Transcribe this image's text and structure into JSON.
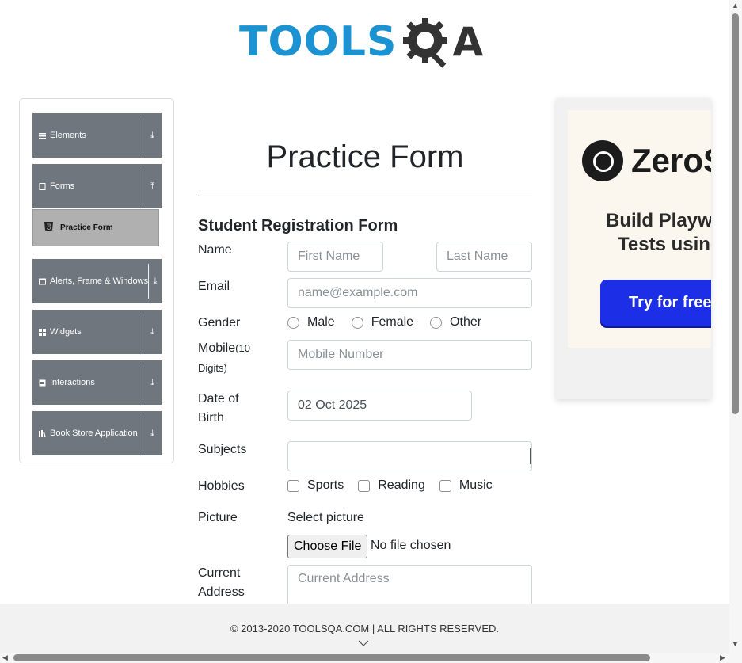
{
  "logo": {
    "text": "TOOLS",
    "suffix": "A"
  },
  "sidebar": {
    "groups": [
      {
        "label": "Elements",
        "icon": "hamburger-icon",
        "arrow": "⤓"
      },
      {
        "label": "Forms",
        "icon": "file-icon",
        "arrow": "⤒"
      },
      {
        "label": "Alerts, Frame & Windows",
        "icon": "window-icon",
        "arrow": "⤓"
      },
      {
        "label": "Widgets",
        "icon": "grid-icon",
        "arrow": "⤓"
      },
      {
        "label": "Interactions",
        "icon": "list-icon",
        "arrow": "⤓"
      },
      {
        "label": "Book Store Application",
        "icon": "books-icon",
        "arrow": "⤓"
      }
    ],
    "active_item": {
      "label": "Practice Form",
      "icon": "html5-icon"
    }
  },
  "main": {
    "title": "Practice Form",
    "subtitle": "Student Registration Form",
    "labels": {
      "name": "Name",
      "email": "Email",
      "gender": "Gender",
      "mobile": "Mobile",
      "mobile_hint": "(10",
      "mobile_hint2": "Digits)",
      "dob_line1": "Date of",
      "dob_line2": "Birth",
      "subjects": "Subjects",
      "hobbies": "Hobbies",
      "picture": "Picture",
      "select_picture": "Select picture",
      "address_line1": "Current",
      "address_line2": "Address"
    },
    "fields": {
      "first_name_placeholder": "First Name",
      "last_name_placeholder": "Last Name",
      "email_placeholder": "name@example.com",
      "mobile_placeholder": "Mobile Number",
      "dob_value": "02 Oct 2025",
      "subjects_value": "",
      "address_placeholder": "Current Address"
    },
    "gender_options": [
      "Male",
      "Female",
      "Other"
    ],
    "hobby_options": [
      "Sports",
      "Reading",
      "Music"
    ],
    "file": {
      "button": "Choose File",
      "status": "No file chosen"
    }
  },
  "ad": {
    "brand": "ZeroSt",
    "line1": "Build Playwri",
    "line2": "Tests using",
    "cta": "Try for free"
  },
  "footer": {
    "text": "© 2013-2020 TOOLSQA.COM | ALL RIGHTS RESERVED."
  },
  "colors": {
    "accent": "#1b92d1",
    "sidebar_group": "#6f767d",
    "active_item": "#b0b0b0",
    "ad_button": "#1c2ee6"
  }
}
